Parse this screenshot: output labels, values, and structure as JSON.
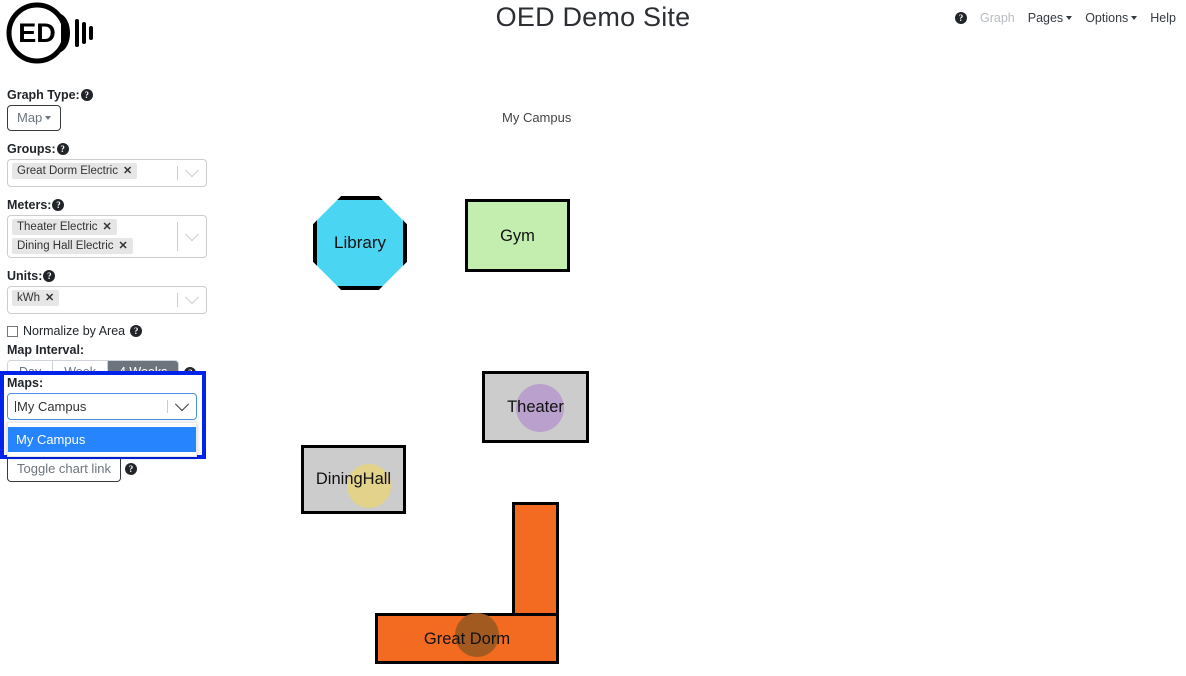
{
  "header": {
    "title": "OED Demo Site",
    "nav": {
      "help_icon": "help-circle-icon",
      "graph": "Graph",
      "pages": "Pages",
      "options": "Options",
      "help": "Help"
    }
  },
  "logo": {
    "text": "ED",
    "alt": "oed-lightbulb-logo"
  },
  "sidebar": {
    "graph_type": {
      "label": "Graph Type:",
      "value": "Map"
    },
    "groups": {
      "label": "Groups:",
      "chips": [
        "Great Dorm Electric"
      ]
    },
    "meters": {
      "label": "Meters:",
      "chips": [
        "Theater Electric",
        "Dining Hall Electric"
      ]
    },
    "units": {
      "label": "Units:",
      "chips": [
        "kWh"
      ]
    },
    "normalize": {
      "label": "Normalize by Area",
      "checked": false
    },
    "map_interval": {
      "label": "Map Interval:",
      "tabs": [
        "Day",
        "Week",
        "4 Weeks"
      ],
      "active": "4 Weeks"
    },
    "maps": {
      "label": "Maps:",
      "value": "My Campus",
      "options": [
        "My Campus"
      ],
      "highlighted": "My Campus",
      "highlight_color": "#0023ec"
    },
    "toggle_chart_link": {
      "label": "Toggle chart link"
    },
    "chip_remove_glyph": "✖"
  },
  "map": {
    "name": "My Campus",
    "buildings": [
      {
        "id": "library",
        "label": "Library",
        "shape": "octagon",
        "fill": "#4ad5f2",
        "marker": null
      },
      {
        "id": "gym",
        "label": "Gym",
        "shape": "rectangle",
        "fill": "#c3eeb0",
        "marker": null
      },
      {
        "id": "theater",
        "label": "Theater",
        "shape": "rectangle",
        "fill": "#cccccc",
        "marker": "#b9a0cd"
      },
      {
        "id": "dining",
        "label": "Dining\nHall",
        "shape": "rectangle",
        "fill": "#cccccc",
        "marker": "#e2d28a"
      },
      {
        "id": "greatdorm",
        "label": "Great Dorm",
        "shape": "L-shape",
        "fill": "#f26b21",
        "marker": "#a35a20"
      }
    ],
    "dining_line1": "Dining",
    "dining_line2": "Hall"
  }
}
